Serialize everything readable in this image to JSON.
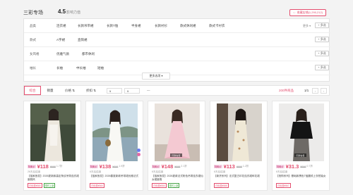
{
  "header": {
    "shop_name": "三彩专场",
    "score": "4.5",
    "score_label": "影响力值",
    "fav_label": "收藏店铺(1,290,212)"
  },
  "filters": {
    "rows": [
      {
        "label": "品类",
        "options": [
          "连衣裙",
          "长款吊带裙",
          "长款T恤",
          "半身裙",
          "长款衬衫",
          "款式休闲裙",
          "款式卡衬衣"
        ],
        "more": "更多 ▾",
        "multi": "+ 多选"
      },
      {
        "label": "款式",
        "options": [
          "A字裙",
          "直筒裙"
        ],
        "more": "",
        "multi": "+ 多选"
      },
      {
        "label": "女风格",
        "options": [
          "优雅气质",
          "都市休闲"
        ],
        "more": "",
        "multi": "+ 多选"
      },
      {
        "label": "袖长",
        "options": [
          "长袖",
          "中长袖",
          "短袖"
        ],
        "more": "",
        "multi": "+ 多选"
      }
    ],
    "more_options": "更多选项 ▾"
  },
  "sortbar": {
    "tabs": [
      "综合",
      "销量",
      "价格 ⇅",
      "折扣 ⇅"
    ],
    "price_min": "¥",
    "price_max": "¥",
    "dash": "—",
    "count_prefix": "",
    "count_num": "200件商品",
    "page": "1/1",
    "prev": "‹",
    "next": "›"
  },
  "products": [
    {
      "badge": "特卖价",
      "price": "¥118",
      "orig": "¥698",
      "disc": "1.7折",
      "sold": "26天后结束",
      "title": "【独家首发】2026夏新款高定条纹吊带连衣裙度假风",
      "chips": [
        "已优惠¥580",
        "限时上新"
      ],
      "tag": ""
    },
    {
      "badge": "特卖价",
      "price": "¥138",
      "orig": "¥698",
      "disc": "1.9折",
      "sold": "6天后结束",
      "title": "【独家首发】2026春夏新款吊带裙优雅法式",
      "chips": [
        "已优惠¥560"
      ],
      "tag": ""
    },
    {
      "badge": "特卖价",
      "price": "¥148",
      "orig": "¥698",
      "disc": "2.1折",
      "sold": "6天后结束",
      "title": "【独家首发】2026夏款法式粉色吊带连衣裙仙女裙度假",
      "chips": [
        "已优惠¥550",
        "限时上新"
      ],
      "tag": "同款在售"
    },
    {
      "badge": "特卖价",
      "price": "¥113",
      "orig": "¥698",
      "disc": "1.2折",
      "sold": "6天后结束",
      "title": "【新货系列】法式复古印花连衣裙碎花裙",
      "chips": [
        "已优惠¥585"
      ],
      "tag": ""
    },
    {
      "badge": "特卖价",
      "price": "¥31.3",
      "orig": "¥598",
      "disc": "0.7折",
      "sold": "6天后结束",
      "title": "【抢购系列】基础款黑色T恤圆领上衣短袖女",
      "chips": [
        "已优惠¥567"
      ],
      "tag": "同款在售"
    }
  ],
  "colors": {
    "accent": "#e34d6e"
  }
}
